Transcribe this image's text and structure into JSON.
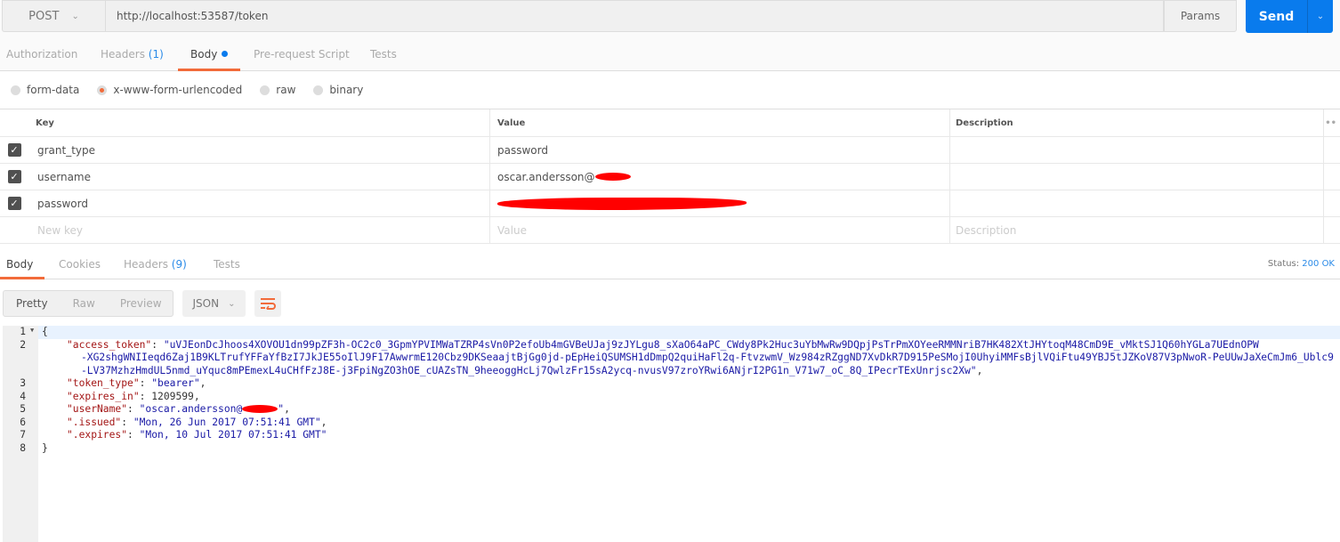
{
  "request": {
    "method": "POST",
    "url": "http://localhost:53587/token",
    "params_label": "Params",
    "send_label": "Send"
  },
  "request_tabs": [
    {
      "label": "Authorization"
    },
    {
      "label": "Headers",
      "count": "(1)"
    },
    {
      "label": "Body",
      "active": true
    },
    {
      "label": "Pre-request Script"
    },
    {
      "label": "Tests"
    }
  ],
  "body_modes": [
    {
      "label": "form-data"
    },
    {
      "label": "x-www-form-urlencoded",
      "selected": true
    },
    {
      "label": "raw"
    },
    {
      "label": "binary"
    }
  ],
  "table": {
    "headers": {
      "key": "Key",
      "value": "Value",
      "description": "Description"
    },
    "rows": [
      {
        "checked": true,
        "key": "grant_type",
        "value": "password"
      },
      {
        "checked": true,
        "key": "username",
        "value": "oscar.andersson@"
      },
      {
        "checked": true,
        "key": "password",
        "value": ""
      }
    ],
    "placeholders": {
      "key": "New key",
      "value": "Value",
      "description": "Description"
    }
  },
  "response_tabs": [
    {
      "label": "Body",
      "active": true
    },
    {
      "label": "Cookies"
    },
    {
      "label": "Headers",
      "count": "(9)"
    },
    {
      "label": "Tests"
    }
  ],
  "status": {
    "label": "Status:",
    "value": "200 OK"
  },
  "view_modes": [
    {
      "label": "Pretty",
      "active": true
    },
    {
      "label": "Raw"
    },
    {
      "label": "Preview"
    }
  ],
  "format": "JSON",
  "response": {
    "line_numbers": [
      "1",
      "2",
      "3",
      "4",
      "5",
      "6",
      "7",
      "8"
    ],
    "open": "{",
    "close": "}",
    "access_token_key": "\"access_token\"",
    "access_token_lines": [
      "\"uVJEonDcJhoos4XOVOU1dn99pZF3h-OC2c0_3GpmYPVIMWaTZRP4sVn0P2efoUb4mGVBeUJaj9zJYLgu8_sXaO64aPC_CWdy8Pk2Huc3uYbMwRw9DQpjPsTrPmXOYeeRMMNriB7HK482XtJHYtoqM48CmD9E_vMktSJ1Q60hYGLa7UEdnOPW",
      "-XG2shgWNIIeqd6Zaj1B9KLTrufYFFaYfBzI7JkJE55oIlJ9F17AwwrmE120Cbz9DKSeaajtBjGg0jd-pEpHeiQSUMSH1dDmpQ2quiHaFl2q-FtvzwmV_Wz984zRZggND7XvDkR7D915PeSMojI0UhyiMMFsBjlVQiFtu49YBJ5tJZKoV87V3pNwoR-PeUUwJaXeCmJm6_Ublc9",
      "-LV37MzhzHmdUL5nmd_uYquc8mPEmexL4uCHfFzJ8E-j3FpiNgZO3hOE_cUAZsTN_9heeoggHcLj7QwlzFr15sA2ycq-nvusV97zroYRwi6ANjrI2PG1n_V71w7_oC_8Q_IPecrTExUnrjsc2Xw\""
    ],
    "token_type_key": "\"token_type\"",
    "token_type": "\"bearer\"",
    "expires_in_key": "\"expires_in\"",
    "expires_in": "1209599",
    "userName_key": "\"userName\"",
    "userName": "\"oscar.andersson@",
    "issued_key": "\".issued\"",
    "issued": "\"Mon, 26 Jun 2017 07:51:41 GMT\"",
    "expires_key": "\".expires\"",
    "expires": "\"Mon, 10 Jul 2017 07:51:41 GMT\""
  },
  "colors": {
    "accent": "#f26b3a",
    "send": "#097bed",
    "redaction": "#ff0000"
  }
}
